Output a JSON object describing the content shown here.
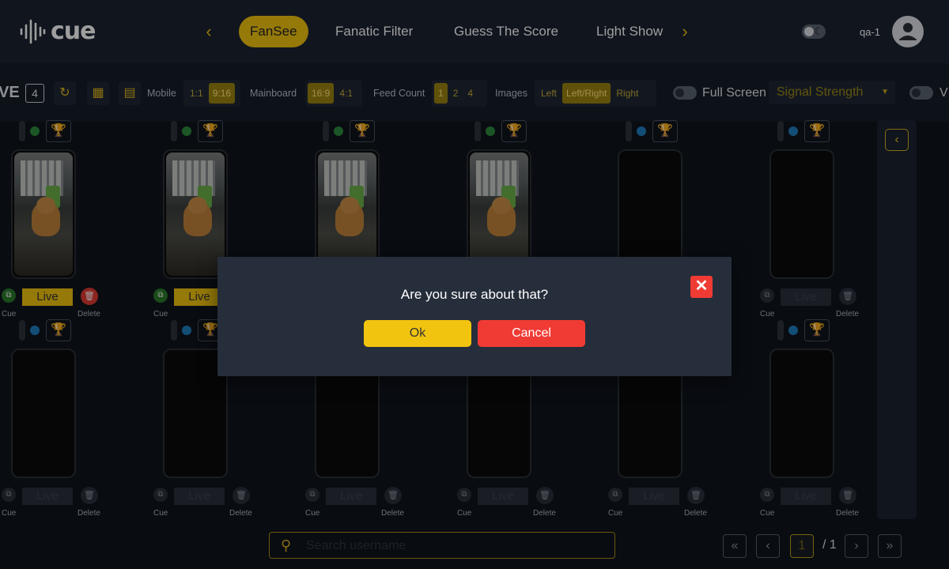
{
  "app": {
    "logo_text": "cue"
  },
  "nav": {
    "prev_icon": "chevron-left-icon",
    "next_icon": "chevron-right-icon",
    "tabs": [
      {
        "label": "FanSee",
        "active": true
      },
      {
        "label": "Fanatic Filter",
        "active": false
      },
      {
        "label": "Guess The Score",
        "active": false
      },
      {
        "label": "Light Show",
        "active": false
      }
    ]
  },
  "user": {
    "name": "qa-1",
    "avatar_icon": "user-avatar-icon"
  },
  "toolbar": {
    "live_partial": "VE",
    "live_count": "4",
    "mobile_label": "Mobile",
    "mobile_options": [
      "1:1",
      "9:16"
    ],
    "mobile_selected": "9:16",
    "mainboard_label": "Mainboard",
    "mainboard_options": [
      "16:9",
      "4:1"
    ],
    "mainboard_selected": "16:9",
    "feed_label": "Feed Count",
    "feed_options": [
      "1",
      "2",
      "4"
    ],
    "feed_selected": "1",
    "images_label": "Images",
    "images_options": [
      "Left",
      "Left/Right",
      "Right"
    ],
    "images_selected": "Left/Right",
    "fullscreen_label": "Full Screen",
    "signal_label": "Signal Strength",
    "trailing_label": "V"
  },
  "cards": {
    "live_label": "Live",
    "cue_label": "Cue",
    "delete_label": "Delete",
    "status_colors": {
      "green": "#2e8b3e",
      "blue": "#1f7fc0"
    }
  },
  "search": {
    "placeholder": "Search username"
  },
  "pagination": {
    "current": "1",
    "total": "/ 1"
  },
  "dialog": {
    "message": "Are you sure about that?",
    "ok_label": "Ok",
    "cancel_label": "Cancel",
    "close_glyph": "✕"
  },
  "colors": {
    "accent": "#f1c40f",
    "danger": "#f03b35",
    "background": "#0f141c",
    "panel": "#1b2331"
  }
}
